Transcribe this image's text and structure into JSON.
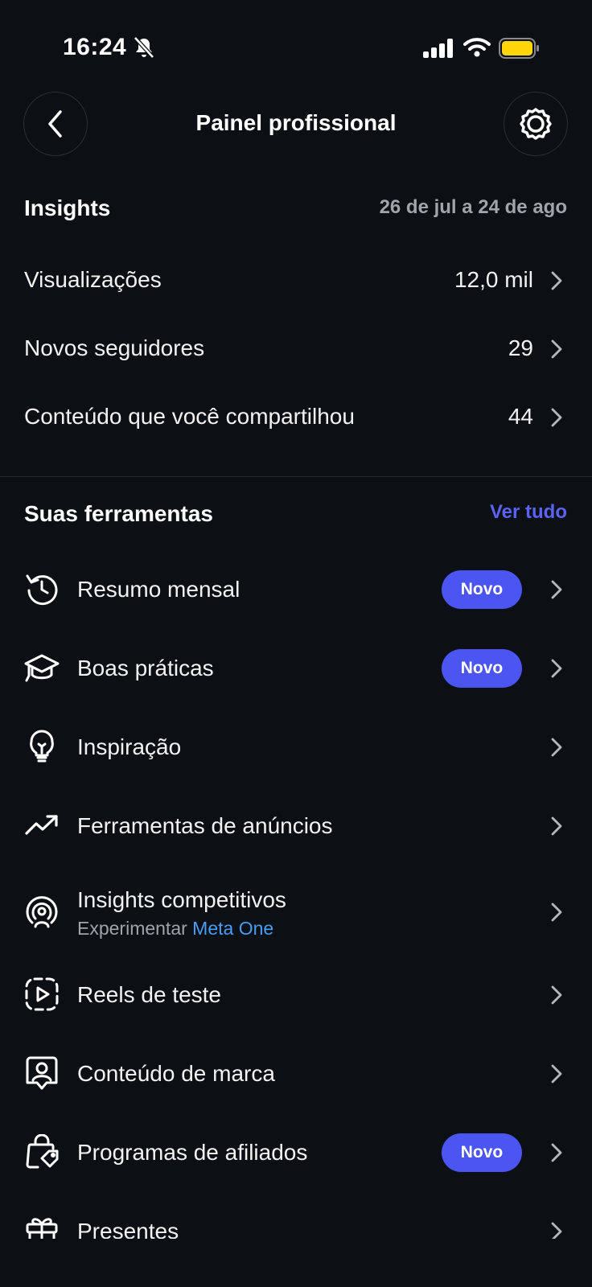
{
  "status_bar": {
    "time": "16:24",
    "battery_color": "#ffd60a"
  },
  "header": {
    "title": "Painel profissional",
    "back_icon": "chevron-left-icon",
    "settings_icon": "gear-icon"
  },
  "insights": {
    "title": "Insights",
    "date_range": "26 de jul a 24 de ago",
    "metrics": [
      {
        "label": "Visualizações",
        "value": "12,0 mil"
      },
      {
        "label": "Novos seguidores",
        "value": "29"
      },
      {
        "label": "Conteúdo que você compartilhou",
        "value": "44"
      }
    ]
  },
  "tools": {
    "title": "Suas ferramentas",
    "see_all": "Ver tudo",
    "items": [
      {
        "label": "Resumo mensal",
        "icon": "history-icon",
        "badge": "Novo"
      },
      {
        "label": "Boas práticas",
        "icon": "graduation-cap-icon",
        "badge": "Novo"
      },
      {
        "label": "Inspiração",
        "icon": "lightbulb-icon"
      },
      {
        "label": "Ferramentas de anúncios",
        "icon": "trending-up-icon"
      },
      {
        "label": "Insights competitivos",
        "icon": "competitor-radar-icon",
        "sub_text": "Experimentar",
        "sub_link": "Meta One"
      },
      {
        "label": "Reels de teste",
        "icon": "reel-play-icon"
      },
      {
        "label": "Conteúdo de marca",
        "icon": "branded-content-icon"
      },
      {
        "label": "Programas de afiliados",
        "icon": "shopping-bag-tag-icon",
        "badge": "Novo"
      },
      {
        "label": "Presentes",
        "icon": "gift-icon"
      }
    ]
  },
  "colors": {
    "background": "#0c0f14",
    "accent": "#4b55f2",
    "link": "#4a9df8"
  }
}
